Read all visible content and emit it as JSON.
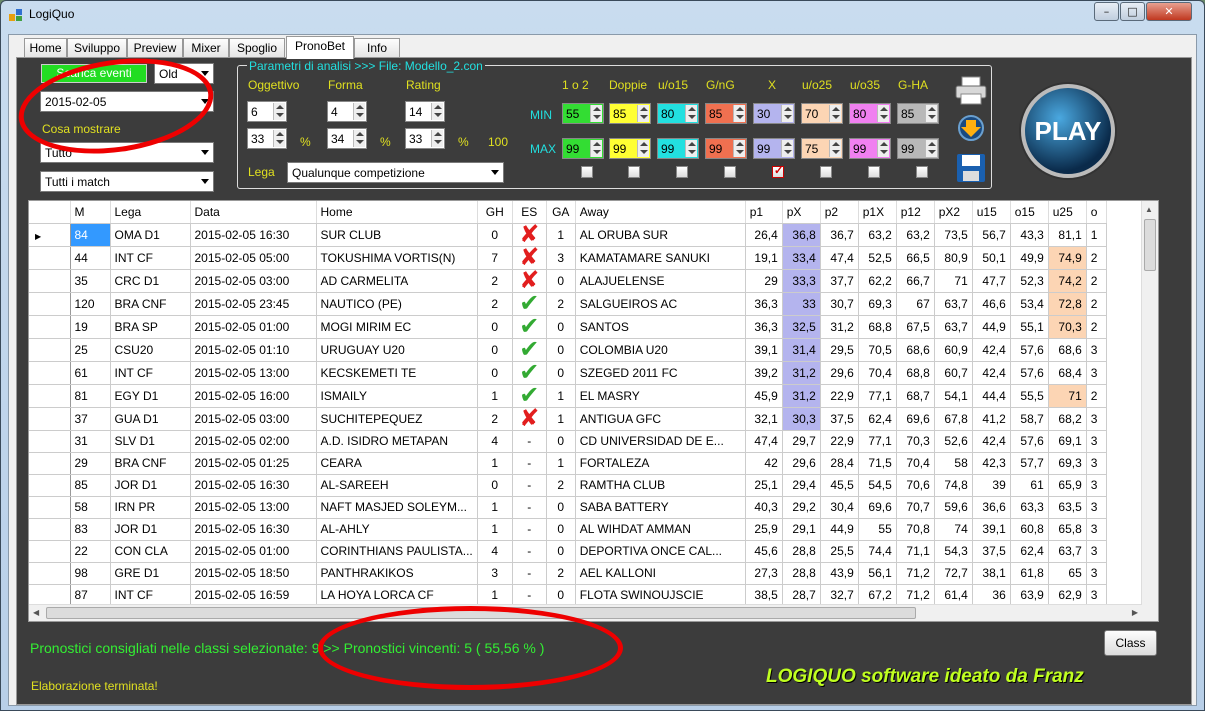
{
  "window": {
    "title": "LogiQuo",
    "min": "–",
    "max": "□",
    "close": "✕"
  },
  "tabs": [
    "Home",
    "Sviluppo",
    "Preview",
    "Mixer",
    "Spoglio",
    "PronoBet",
    "Info"
  ],
  "left": {
    "download_button": "Scarica eventi",
    "mode_combo": "Old",
    "date_combo": "2015-02-05",
    "show_label": "Cosa mostrare",
    "filter_combo": "Tutto",
    "match_combo": "Tutti i match"
  },
  "params": {
    "title": "Parametri di analisi >>> File: Modello_2.con",
    "oggettivo": {
      "label": "Oggettivo",
      "v1": "6",
      "v2": "33"
    },
    "forma": {
      "label": "Forma",
      "v1": "4",
      "v2": "34"
    },
    "rating": {
      "label": "Rating",
      "v1": "14",
      "v2": "33"
    },
    "pct": "%",
    "hundred": "100",
    "lega_label": "Lega",
    "lega_combo": "Qualunque competizione",
    "min_label": "MIN",
    "max_label": "MAX",
    "classes": [
      {
        "label": "1 o 2",
        "min": "55",
        "max": "99",
        "color": "#33dd33",
        "checked": false
      },
      {
        "label": "Doppie",
        "min": "85",
        "max": "99",
        "color": "#ffff33",
        "checked": false
      },
      {
        "label": "u/o15",
        "min": "80",
        "max": "99",
        "color": "#22e0e0",
        "checked": false
      },
      {
        "label": "G/nG",
        "min": "85",
        "max": "99",
        "color": "#f07050",
        "checked": false
      },
      {
        "label": "X",
        "min": "30",
        "max": "99",
        "color": "#b4b4ee",
        "checked": true
      },
      {
        "label": "u/o25",
        "min": "70",
        "max": "75",
        "color": "#fcd5b4",
        "checked": false
      },
      {
        "label": "u/o35",
        "min": "80",
        "max": "99",
        "color": "#f080f0",
        "checked": false
      },
      {
        "label": "G-HA",
        "min": "85",
        "max": "99",
        "color": "#b8b8b8",
        "checked": false
      }
    ]
  },
  "play_button": "PLAY",
  "icons": [
    "printer-icon",
    "download-icon",
    "save-icon"
  ],
  "grid": {
    "columns": [
      "M",
      "Lega",
      "Data",
      "Home",
      "GH",
      "ES",
      "GA",
      "Away",
      "p1",
      "pX",
      "p2",
      "p1X",
      "p12",
      "pX2",
      "u15",
      "o15",
      "u25",
      "o"
    ],
    "rows": [
      {
        "m": "84",
        "lega": "OMA D1",
        "data": "2015-02-05 16:30",
        "home": "SUR CLUB",
        "gh": "0",
        "es": "x",
        "ga": "1",
        "away": "AL ORUBA SUR",
        "p1": "26,4",
        "px": "36,8",
        "p2": "36,7",
        "p1x": "63,2",
        "p12": "63,2",
        "px2": "73,5",
        "u15": "56,7",
        "o15": "43,3",
        "u25": "81,1",
        "o": "1",
        "bx": true,
        "ou": false
      },
      {
        "m": "44",
        "lega": "INT CF",
        "data": "2015-02-05 05:00",
        "home": "TOKUSHIMA VORTIS(N)",
        "gh": "7",
        "es": "x",
        "ga": "3",
        "away": "KAMATAMARE SANUKI",
        "p1": "19,1",
        "px": "33,4",
        "p2": "47,4",
        "p1x": "52,5",
        "p12": "66,5",
        "px2": "80,9",
        "u15": "50,1",
        "o15": "49,9",
        "u25": "74,9",
        "o": "2",
        "bx": true,
        "ou": true
      },
      {
        "m": "35",
        "lega": "CRC D1",
        "data": "2015-02-05 03:00",
        "home": "AD CARMELITA",
        "gh": "2",
        "es": "x",
        "ga": "0",
        "away": "ALAJUELENSE",
        "p1": "29",
        "px": "33,3",
        "p2": "37,7",
        "p1x": "62,2",
        "p12": "66,7",
        "px2": "71",
        "u15": "47,7",
        "o15": "52,3",
        "u25": "74,2",
        "o": "2",
        "bx": true,
        "ou": true
      },
      {
        "m": "120",
        "lega": "BRA CNF",
        "data": "2015-02-05 23:45",
        "home": "NAUTICO (PE)",
        "gh": "2",
        "es": "v",
        "ga": "2",
        "away": "SALGUEIROS AC",
        "p1": "36,3",
        "px": "33",
        "p2": "30,7",
        "p1x": "69,3",
        "p12": "67",
        "px2": "63,7",
        "u15": "46,6",
        "o15": "53,4",
        "u25": "72,8",
        "o": "2",
        "bx": true,
        "ou": true
      },
      {
        "m": "19",
        "lega": "BRA SP",
        "data": "2015-02-05 01:00",
        "home": "MOGI MIRIM EC",
        "gh": "0",
        "es": "v",
        "ga": "0",
        "away": "SANTOS",
        "p1": "36,3",
        "px": "32,5",
        "p2": "31,2",
        "p1x": "68,8",
        "p12": "67,5",
        "px2": "63,7",
        "u15": "44,9",
        "o15": "55,1",
        "u25": "70,3",
        "o": "2",
        "bx": true,
        "ou": true
      },
      {
        "m": "25",
        "lega": "CSU20",
        "data": "2015-02-05 01:10",
        "home": "URUGUAY U20",
        "gh": "0",
        "es": "v",
        "ga": "0",
        "away": "COLOMBIA U20",
        "p1": "39,1",
        "px": "31,4",
        "p2": "29,5",
        "p1x": "70,5",
        "p12": "68,6",
        "px2": "60,9",
        "u15": "42,4",
        "o15": "57,6",
        "u25": "68,6",
        "o": "3",
        "bx": true,
        "ou": false
      },
      {
        "m": "61",
        "lega": "INT CF",
        "data": "2015-02-05 13:00",
        "home": "KECSKEMETI TE",
        "gh": "0",
        "es": "v",
        "ga": "0",
        "away": "SZEGED 2011 FC",
        "p1": "39,2",
        "px": "31,2",
        "p2": "29,6",
        "p1x": "70,4",
        "p12": "68,8",
        "px2": "60,7",
        "u15": "42,4",
        "o15": "57,6",
        "u25": "68,4",
        "o": "3",
        "bx": true,
        "ou": false
      },
      {
        "m": "81",
        "lega": "EGY D1",
        "data": "2015-02-05 16:00",
        "home": "ISMAILY",
        "gh": "1",
        "es": "v",
        "ga": "1",
        "away": "EL MASRY",
        "p1": "45,9",
        "px": "31,2",
        "p2": "22,9",
        "p1x": "77,1",
        "p12": "68,7",
        "px2": "54,1",
        "u15": "44,4",
        "o15": "55,5",
        "u25": "71",
        "o": "2",
        "bx": true,
        "ou": true
      },
      {
        "m": "37",
        "lega": "GUA D1",
        "data": "2015-02-05 03:00",
        "home": "SUCHITEPEQUEZ",
        "gh": "2",
        "es": "x",
        "ga": "1",
        "away": "ANTIGUA GFC",
        "p1": "32,1",
        "px": "30,3",
        "p2": "37,5",
        "p1x": "62,4",
        "p12": "69,6",
        "px2": "67,8",
        "u15": "41,2",
        "o15": "58,7",
        "u25": "68,2",
        "o": "3",
        "bx": true,
        "ou": false
      },
      {
        "m": "31",
        "lega": "SLV D1",
        "data": "2015-02-05 02:00",
        "home": "A.D. ISIDRO METAPAN",
        "gh": "4",
        "es": "-",
        "ga": "0",
        "away": "CD UNIVERSIDAD DE E...",
        "p1": "47,4",
        "px": "29,7",
        "p2": "22,9",
        "p1x": "77,1",
        "p12": "70,3",
        "px2": "52,6",
        "u15": "42,4",
        "o15": "57,6",
        "u25": "69,1",
        "o": "3",
        "bx": false,
        "ou": false
      },
      {
        "m": "29",
        "lega": "BRA CNF",
        "data": "2015-02-05 01:25",
        "home": "CEARA",
        "gh": "1",
        "es": "-",
        "ga": "1",
        "away": "FORTALEZA",
        "p1": "42",
        "px": "29,6",
        "p2": "28,4",
        "p1x": "71,5",
        "p12": "70,4",
        "px2": "58",
        "u15": "42,3",
        "o15": "57,7",
        "u25": "69,3",
        "o": "3",
        "bx": false,
        "ou": false
      },
      {
        "m": "85",
        "lega": "JOR D1",
        "data": "2015-02-05 16:30",
        "home": "AL-SAREEH",
        "gh": "0",
        "es": "-",
        "ga": "2",
        "away": "RAMTHA CLUB",
        "p1": "25,1",
        "px": "29,4",
        "p2": "45,5",
        "p1x": "54,5",
        "p12": "70,6",
        "px2": "74,8",
        "u15": "39",
        "o15": "61",
        "u25": "65,9",
        "o": "3",
        "bx": false,
        "ou": false
      },
      {
        "m": "58",
        "lega": "IRN PR",
        "data": "2015-02-05 13:00",
        "home": "NAFT MASJED SOLEYM...",
        "gh": "1",
        "es": "-",
        "ga": "0",
        "away": "SABA BATTERY",
        "p1": "40,3",
        "px": "29,2",
        "p2": "30,4",
        "p1x": "69,6",
        "p12": "70,7",
        "px2": "59,6",
        "u15": "36,6",
        "o15": "63,3",
        "u25": "63,5",
        "o": "3",
        "bx": false,
        "ou": false
      },
      {
        "m": "83",
        "lega": "JOR D1",
        "data": "2015-02-05 16:30",
        "home": "AL-AHLY",
        "gh": "1",
        "es": "-",
        "ga": "0",
        "away": "AL WIHDAT AMMAN",
        "p1": "25,9",
        "px": "29,1",
        "p2": "44,9",
        "p1x": "55",
        "p12": "70,8",
        "px2": "74",
        "u15": "39,1",
        "o15": "60,8",
        "u25": "65,8",
        "o": "3",
        "bx": false,
        "ou": false
      },
      {
        "m": "22",
        "lega": "CON CLA",
        "data": "2015-02-05 01:00",
        "home": "CORINTHIANS PAULISTA...",
        "gh": "4",
        "es": "-",
        "ga": "0",
        "away": "DEPORTIVA ONCE CAL...",
        "p1": "45,6",
        "px": "28,8",
        "p2": "25,5",
        "p1x": "74,4",
        "p12": "71,1",
        "px2": "54,3",
        "u15": "37,5",
        "o15": "62,4",
        "u25": "63,7",
        "o": "3",
        "bx": false,
        "ou": false
      },
      {
        "m": "98",
        "lega": "GRE D1",
        "data": "2015-02-05 18:50",
        "home": "PANTHRAKIKOS",
        "gh": "3",
        "es": "-",
        "ga": "2",
        "away": "AEL KALLONI",
        "p1": "27,3",
        "px": "28,8",
        "p2": "43,9",
        "p1x": "56,1",
        "p12": "71,2",
        "px2": "72,7",
        "u15": "38,1",
        "o15": "61,8",
        "u25": "65",
        "o": "3",
        "bx": false,
        "ou": false
      },
      {
        "m": "87",
        "lega": "INT CF",
        "data": "2015-02-05 16:59",
        "home": "LA HOYA LORCA CF",
        "gh": "1",
        "es": "-",
        "ga": "0",
        "away": "FLOTA SWINOUJSCIE",
        "p1": "38,5",
        "px": "28,7",
        "p2": "32,7",
        "p1x": "67,2",
        "p12": "71,2",
        "px2": "61,4",
        "u15": "36",
        "o15": "63,9",
        "u25": "62,9",
        "o": "3",
        "bx": false,
        "ou": false
      }
    ]
  },
  "status": {
    "summary": "Pronostici consigliati nelle classi selezionate: 9 >> Pronostici vincenti: 5 ( 55,56 % )",
    "class_button": "Class",
    "state": "Elaborazione terminata!",
    "brand": "LOGIQUO software ideato da Franz"
  }
}
